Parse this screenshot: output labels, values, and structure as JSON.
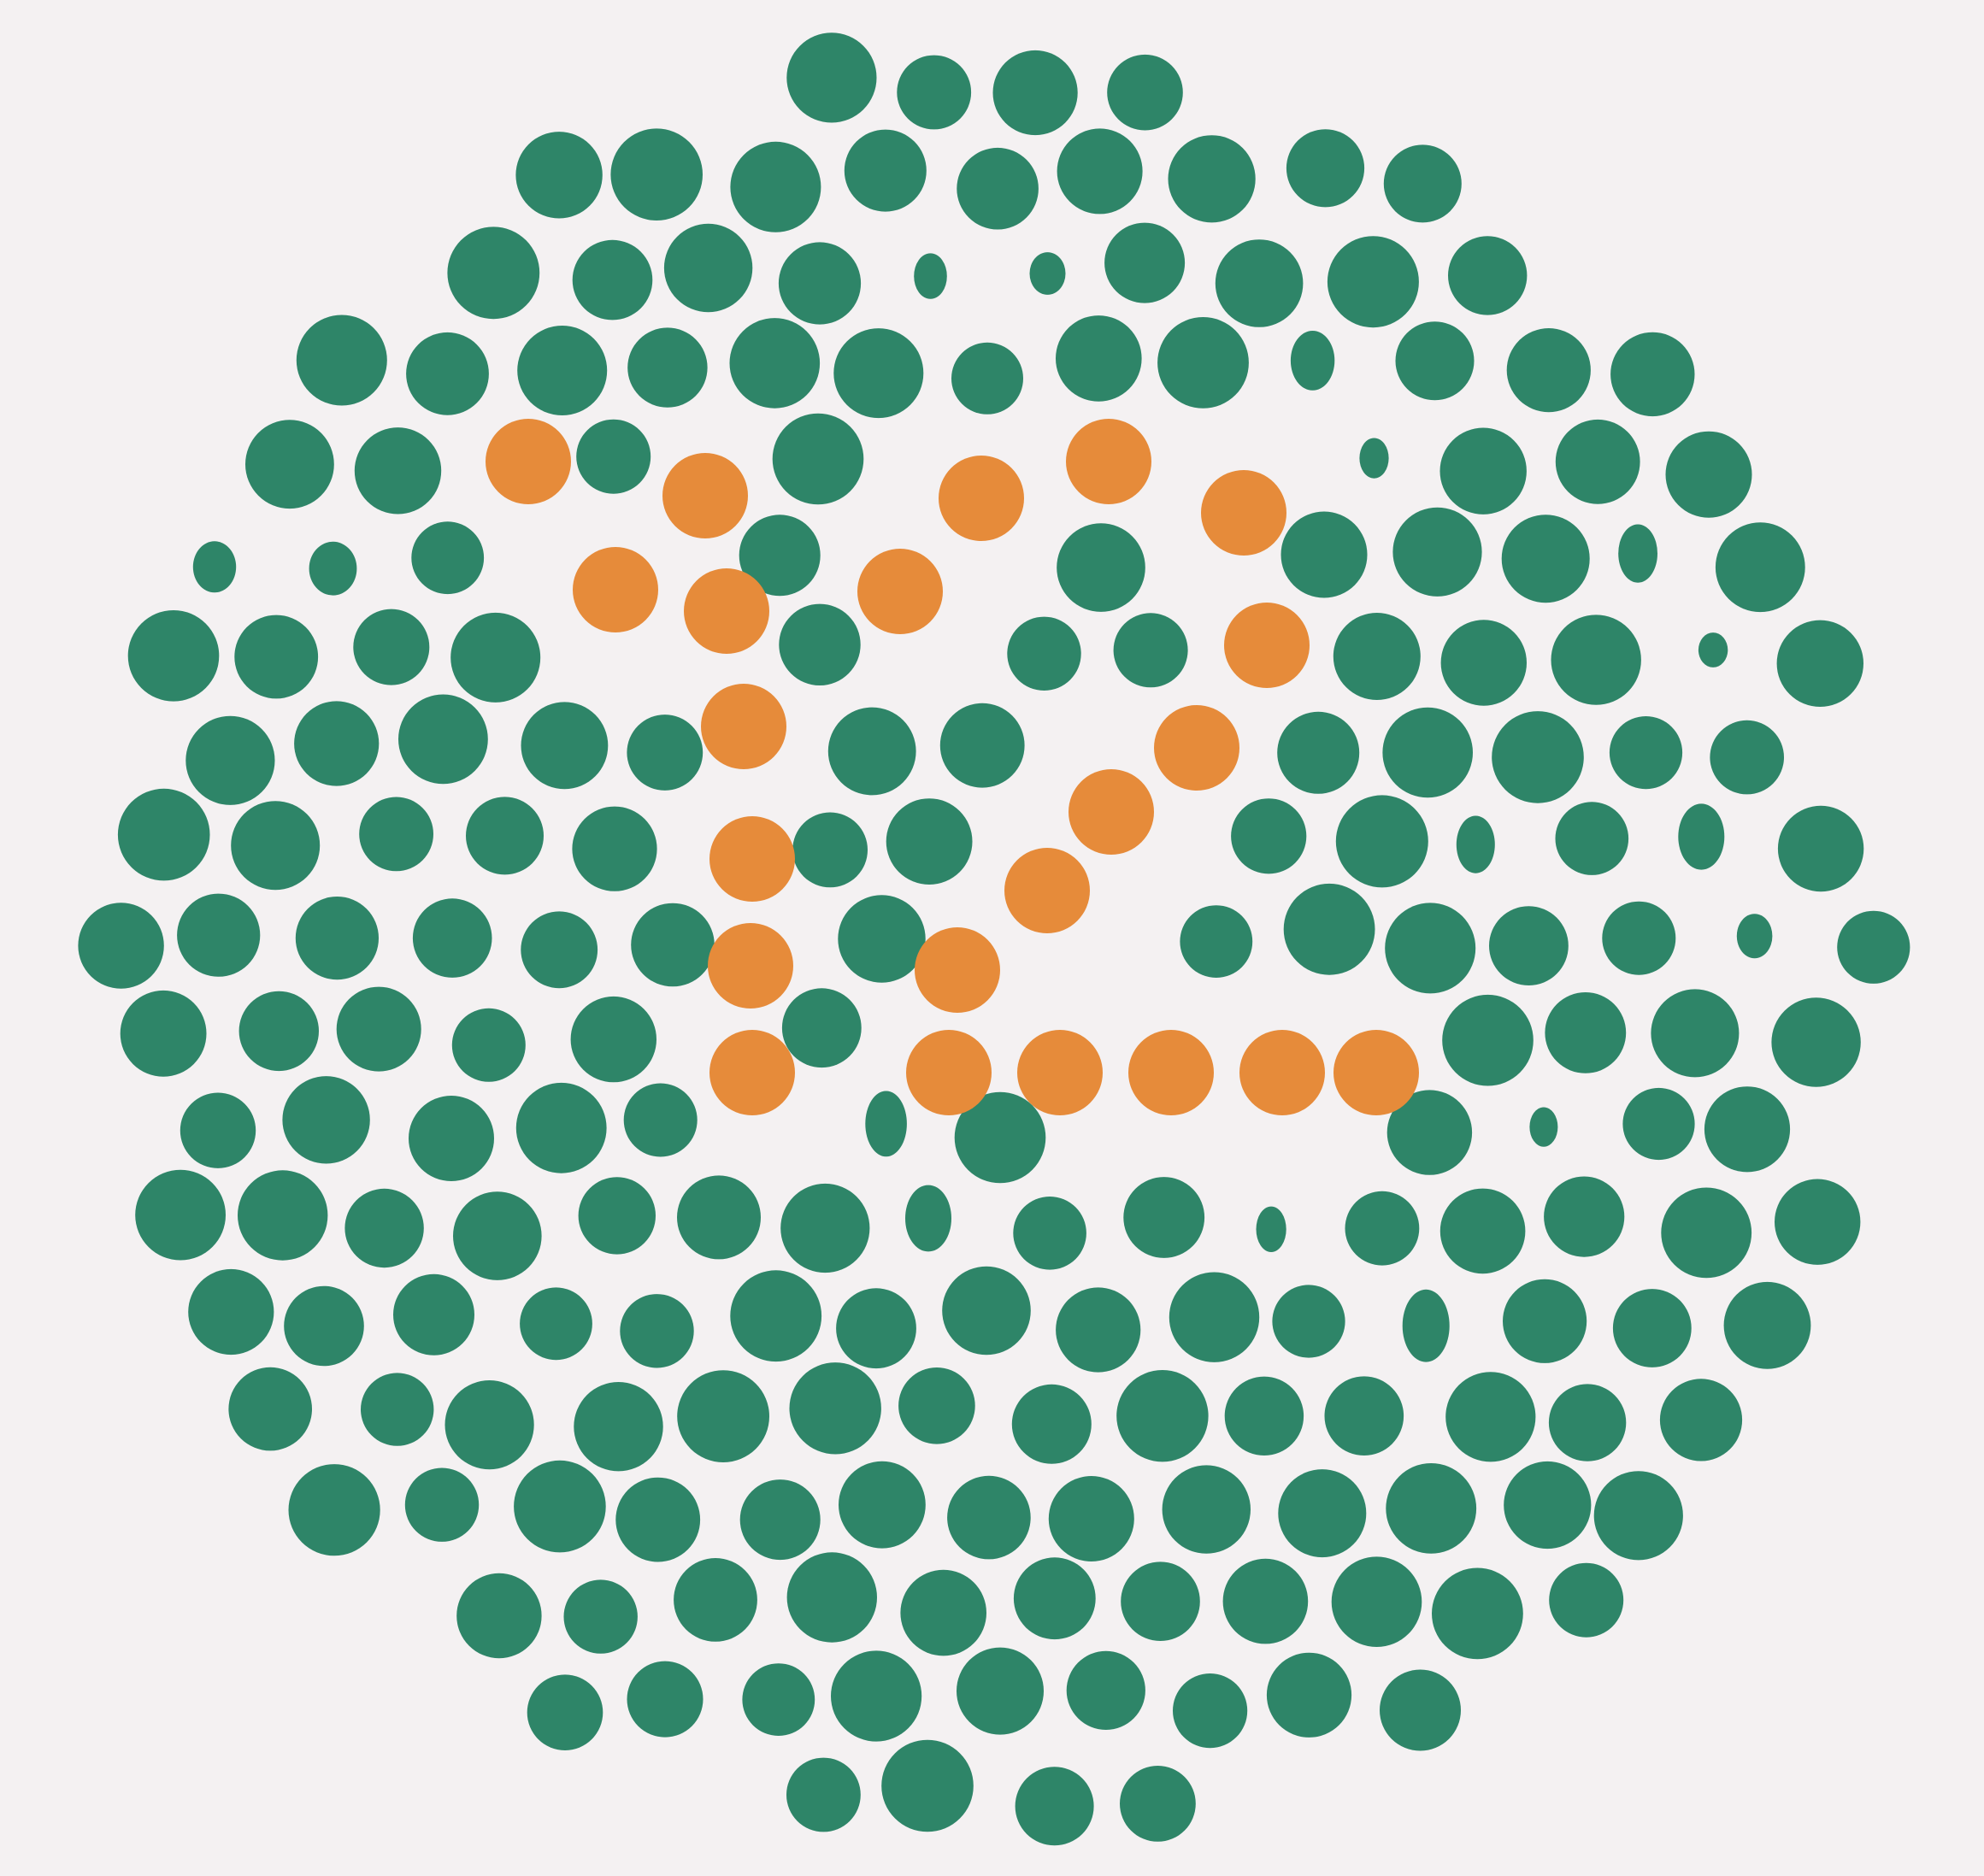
{
  "plate": {
    "kind": "color-vision-test-plate",
    "figure_shown": "2",
    "background_color": "#f4f1f2",
    "background_dot_color": "#2e8568",
    "figure_dot_color": "#e68b3a"
  }
}
